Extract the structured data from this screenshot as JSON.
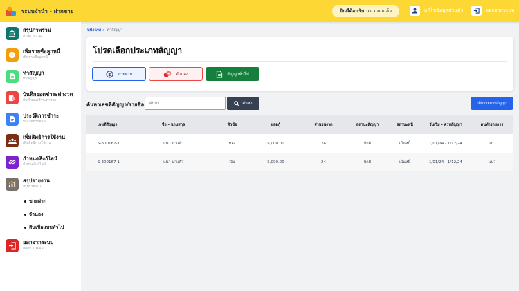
{
  "header": {
    "title": "ระบบจำนำ - ฝากขาย",
    "welcome_label": "ยินดีต้อนรับ",
    "user_name": "แนว มาแล้ว",
    "profile_label": "แก้ไขข้อมูลส่วนตัว",
    "logout_label": "ออกจากระบบ"
  },
  "sidebar": {
    "items": [
      {
        "label": "สรุปภาพรวม",
        "sub": "สรุปภาพรวม",
        "icon": "bank-icon",
        "color": "#0f766e"
      },
      {
        "label": "เพิ่มรายชื่อลูกหนี้",
        "sub": "เพิ่มรายชื่อลูกหนี้",
        "icon": "add-user-icon",
        "color": "#f59e0b"
      },
      {
        "label": "ทำสัญญา",
        "sub": "ทำสัญญา",
        "icon": "document-icon",
        "color": "#4ade80"
      },
      {
        "label": "บันทึกยอดชำระค่างวด",
        "sub": "บันทึกยอดชำระค่างวด",
        "icon": "payment-icon",
        "color": "#ef4444"
      },
      {
        "label": "ประวัติการชำระ",
        "sub": "ประวัติการชำระ",
        "icon": "history-icon",
        "color": "#3b82f6"
      },
      {
        "label": "เพิ่มสิทธิการใช้งาน",
        "sub": "เพิ่มสิทธิการใช้งาน",
        "icon": "users-icon",
        "color": "#7c2d12"
      },
      {
        "label": "กำหนดลิงก์ไลน์",
        "sub": "กำหนดลิงก์ไลน์",
        "icon": "link-icon",
        "color": "#7e22ce"
      },
      {
        "label": "สรุปรายงาน",
        "sub": "สรุปรายงาน",
        "icon": "report-icon",
        "color": "#78716c"
      }
    ],
    "sub_items": [
      "ขายฝาก",
      "จำนอง",
      "สินเชื่อแบบทั่วไป"
    ],
    "logout": {
      "label": "ออกจากระบบ",
      "sub": "ออกจากระบบ",
      "icon": "logout-icon",
      "color": "#dc2626"
    }
  },
  "breadcrumb": {
    "home": "หน้าแรก",
    "sep": ">",
    "current": "ทำสัญญา"
  },
  "card": {
    "title": "โปรดเลือกประเภทสัญญา",
    "buttons": [
      {
        "label": "ขายฝาก",
        "icon": "dollar-icon"
      },
      {
        "label": "จำนอง",
        "icon": "coins-icon"
      },
      {
        "label": "สัญญาทั่วไป",
        "icon": "contract-icon"
      }
    ]
  },
  "search": {
    "label": "ค้นหาเลขที่สัญญา/รายชื่อ",
    "placeholder": "ค้นหา",
    "button": "ค้นหา",
    "add_button": "เพิ่มรายการสัญญา"
  },
  "table": {
    "headers": [
      "เลขที่สัญญา",
      "ชื่อ - นามสกุล",
      "หัวข้อ",
      "ยอดกู้",
      "จำนวนงวด",
      "สถานะสัญญา",
      "สถานะหนี้",
      "วันเริ่ม - ครบสัญญา",
      "คนทำรายการ"
    ],
    "rows": [
      [
        "S-300167-1",
        "แนว มาแล้ว",
        "ทอง",
        "5,000.00",
        "24",
        "ปกติ",
        "เป็นหนี้",
        "1/01/24 - 1/12/24",
        "แนว"
      ],
      [
        "S-300167-1",
        "แนว มาแล้ว",
        "เงิน",
        "5,000.00",
        "24",
        "ปกติ",
        "เป็นหนี้",
        "1/01/24 - 1/12/24",
        "แนว"
      ]
    ]
  },
  "colors": {
    "topbar": "#fdd835",
    "primary": "#2563eb",
    "green": "#15803d",
    "red": "#dc2626"
  }
}
